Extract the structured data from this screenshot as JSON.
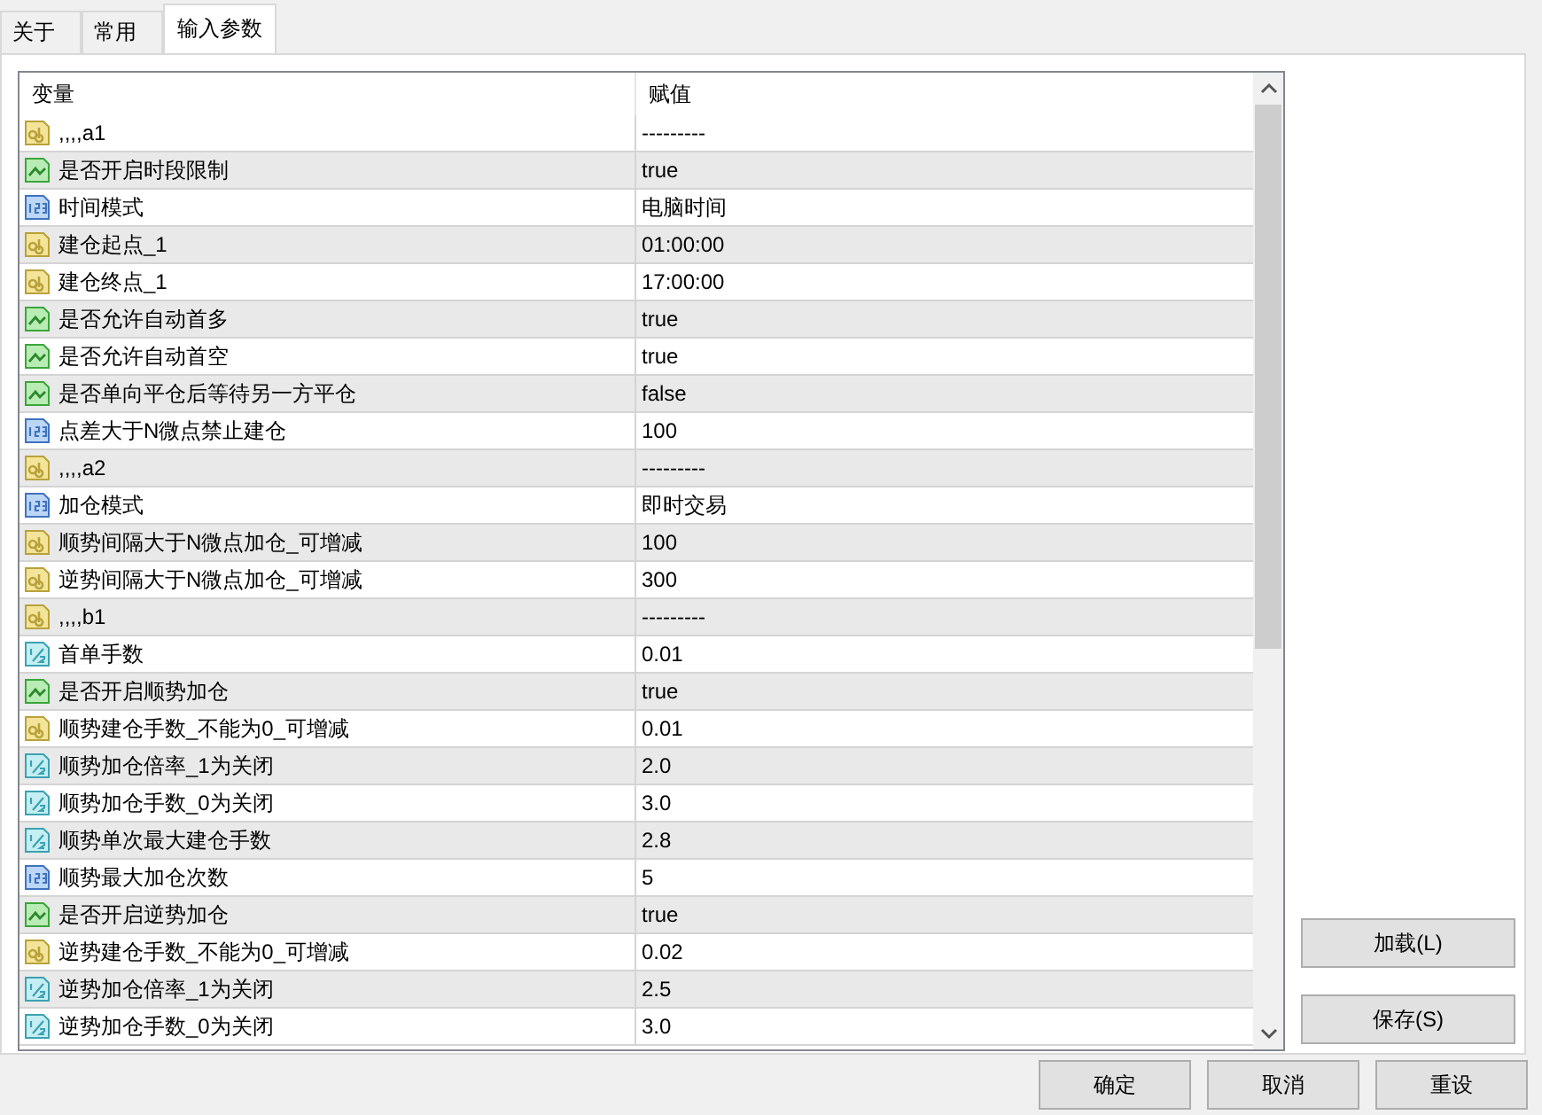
{
  "tabs": [
    {
      "label": "关于",
      "selected": false
    },
    {
      "label": "常用",
      "selected": false
    },
    {
      "label": "输入参数",
      "selected": true
    }
  ],
  "table": {
    "columns": [
      "变量",
      "赋值"
    ],
    "rows": [
      {
        "kind": "string",
        "name": ",,,,a1",
        "value": "---------"
      },
      {
        "kind": "bool",
        "name": "是否开启时段限制",
        "value": "true"
      },
      {
        "kind": "int",
        "name": "时间模式",
        "value": "电脑时间"
      },
      {
        "kind": "string",
        "name": "建仓起点_1",
        "value": "01:00:00"
      },
      {
        "kind": "string",
        "name": "建仓终点_1",
        "value": "17:00:00"
      },
      {
        "kind": "bool",
        "name": "是否允许自动首多",
        "value": "true"
      },
      {
        "kind": "bool",
        "name": "是否允许自动首空",
        "value": "true"
      },
      {
        "kind": "bool",
        "name": "是否单向平仓后等待另一方平仓",
        "value": "false"
      },
      {
        "kind": "int",
        "name": "点差大于N微点禁止建仓",
        "value": "100"
      },
      {
        "kind": "string",
        "name": ",,,,a2",
        "value": "---------"
      },
      {
        "kind": "int",
        "name": "加仓模式",
        "value": "即时交易"
      },
      {
        "kind": "string",
        "name": "顺势间隔大于N微点加仓_可增减",
        "value": "100"
      },
      {
        "kind": "string",
        "name": "逆势间隔大于N微点加仓_可增减",
        "value": "300"
      },
      {
        "kind": "string",
        "name": ",,,,b1",
        "value": "---------"
      },
      {
        "kind": "double",
        "name": "首单手数",
        "value": "0.01"
      },
      {
        "kind": "bool",
        "name": "是否开启顺势加仓",
        "value": "true"
      },
      {
        "kind": "string",
        "name": "顺势建仓手数_不能为0_可增减",
        "value": "0.01"
      },
      {
        "kind": "double",
        "name": "顺势加仓倍率_1为关闭",
        "value": "2.0"
      },
      {
        "kind": "double",
        "name": "顺势加仓手数_0为关闭",
        "value": "3.0"
      },
      {
        "kind": "double",
        "name": "顺势单次最大建仓手数",
        "value": "2.8"
      },
      {
        "kind": "int",
        "name": "顺势最大加仓次数",
        "value": "5"
      },
      {
        "kind": "bool",
        "name": "是否开启逆势加仓",
        "value": "true"
      },
      {
        "kind": "string",
        "name": "逆势建仓手数_不能为0_可增减",
        "value": "0.02"
      },
      {
        "kind": "double",
        "name": "逆势加仓倍率_1为关闭",
        "value": "2.5"
      },
      {
        "kind": "double",
        "name": "逆势加仓手数_0为关闭",
        "value": "3.0"
      }
    ]
  },
  "side_buttons": [
    "加载(L)",
    "保存(S)"
  ],
  "buttons": [
    "确定",
    "取消",
    "重设"
  ]
}
